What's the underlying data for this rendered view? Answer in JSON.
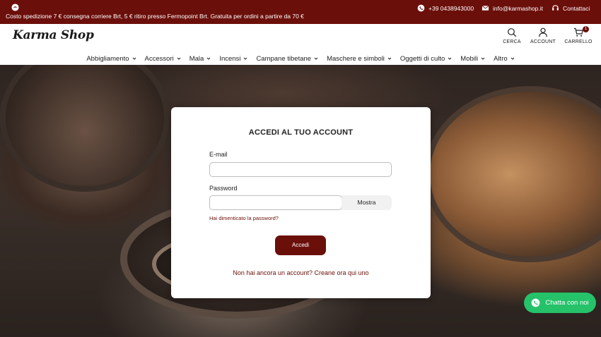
{
  "topbar": {
    "promo": "Costo spedizione 7 € consegna corriere Brt, 5 € ritiro presso Fermopoint Brt. Gratuita per ordini a partire da 70 €",
    "phone": "+39 0438943000",
    "email": "info@karmashop.it",
    "contact": "Contattaci"
  },
  "header": {
    "brand_main": "Karma Shop",
    "search_label": "CERCA",
    "account_label": "ACCOUNT",
    "cart_label": "CARRELLO",
    "cart_count": "1"
  },
  "nav": {
    "items": [
      "Abbigliamento",
      "Accessori",
      "Mala",
      "Incensi",
      "Campane tibetane",
      "Maschere e simboli",
      "Oggetti di culto",
      "Mobili",
      "Altro"
    ]
  },
  "login": {
    "title": "ACCEDI AL TUO ACCOUNT",
    "email_label": "E-mail",
    "email_value": "",
    "password_label": "Password",
    "password_value": "",
    "show_label": "Mostra",
    "forgot": "Hai dimenticato la password?",
    "submit": "Accedi",
    "signup": "Non hai ancora un account? Creane ora qui uno"
  },
  "chat": {
    "label": "Chatta con noi"
  },
  "colors": {
    "brand": "#6b0f0b",
    "whatsapp": "#25c26a"
  }
}
